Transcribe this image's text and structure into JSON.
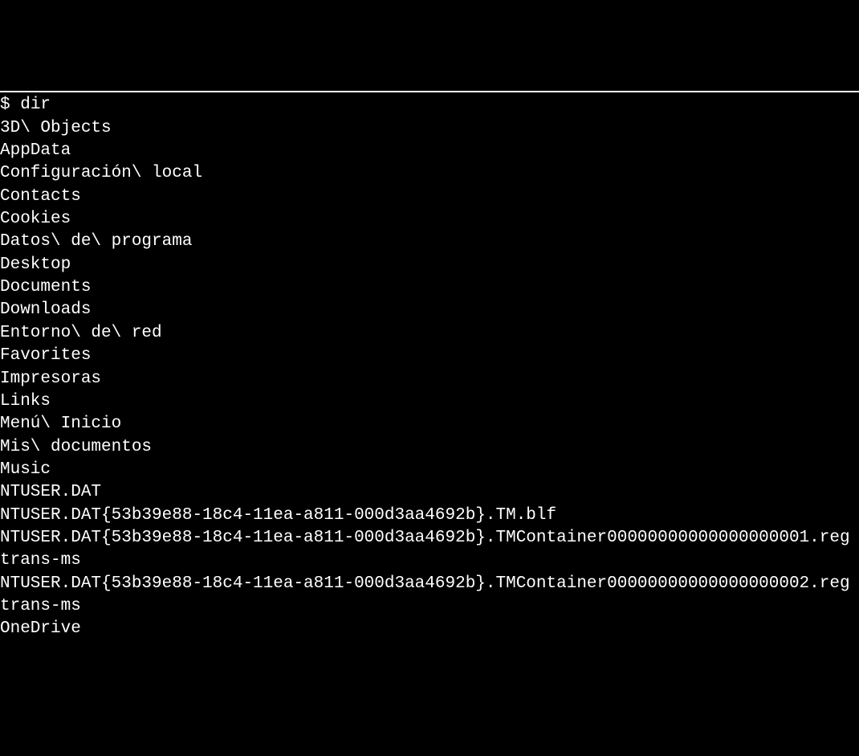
{
  "terminal": {
    "prompt": "$ ",
    "command": "dir",
    "output": [
      "3D\\ Objects",
      "AppData",
      "Configuración\\ local",
      "Contacts",
      "Cookies",
      "Datos\\ de\\ programa",
      "Desktop",
      "Documents",
      "Downloads",
      "Entorno\\ de\\ red",
      "Favorites",
      "Impresoras",
      "Links",
      "Menú\\ Inicio",
      "Mis\\ documentos",
      "Music",
      "NTUSER.DAT",
      "NTUSER.DAT{53b39e88-18c4-11ea-a811-000d3aa4692b}.TM.blf",
      "NTUSER.DAT{53b39e88-18c4-11ea-a811-000d3aa4692b}.TMContainer00000000000000000001.regtrans-ms",
      "NTUSER.DAT{53b39e88-18c4-11ea-a811-000d3aa4692b}.TMContainer00000000000000000002.regtrans-ms",
      "OneDrive"
    ]
  }
}
